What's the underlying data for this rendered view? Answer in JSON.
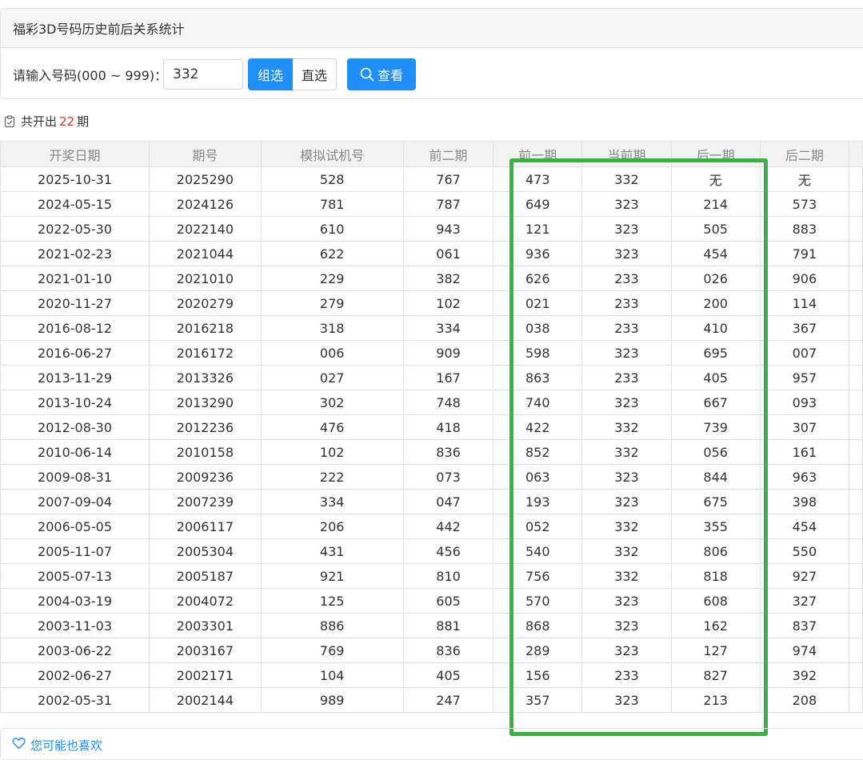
{
  "panel": {
    "title": "福彩3D号码历史前后关系统计",
    "input_label": "请输入号码(000 ~ 999)：",
    "input_value": "332",
    "mode_group": "组选",
    "mode_direct": "直选",
    "search_label": "查看"
  },
  "summary": {
    "prefix": "共开出",
    "count": "22",
    "suffix": "期"
  },
  "table": {
    "headers": [
      "开奖日期",
      "期号",
      "模拟试机号",
      "前二期",
      "前一期",
      "当前期",
      "后一期",
      "后二期"
    ],
    "rows": [
      [
        "2025-10-31",
        "2025290",
        "528",
        "767",
        "473",
        "332",
        "无",
        "无"
      ],
      [
        "2024-05-15",
        "2024126",
        "781",
        "787",
        "649",
        "323",
        "214",
        "573"
      ],
      [
        "2022-05-30",
        "2022140",
        "610",
        "943",
        "121",
        "323",
        "505",
        "883"
      ],
      [
        "2021-02-23",
        "2021044",
        "622",
        "061",
        "936",
        "323",
        "454",
        "791"
      ],
      [
        "2021-01-10",
        "2021010",
        "229",
        "382",
        "626",
        "233",
        "026",
        "906"
      ],
      [
        "2020-11-27",
        "2020279",
        "279",
        "102",
        "021",
        "233",
        "200",
        "114"
      ],
      [
        "2016-08-12",
        "2016218",
        "318",
        "334",
        "038",
        "233",
        "410",
        "367"
      ],
      [
        "2016-06-27",
        "2016172",
        "006",
        "909",
        "598",
        "323",
        "695",
        "007"
      ],
      [
        "2013-11-29",
        "2013326",
        "027",
        "167",
        "863",
        "233",
        "405",
        "957"
      ],
      [
        "2013-10-24",
        "2013290",
        "302",
        "748",
        "740",
        "323",
        "667",
        "093"
      ],
      [
        "2012-08-30",
        "2012236",
        "476",
        "418",
        "422",
        "332",
        "739",
        "307"
      ],
      [
        "2010-06-14",
        "2010158",
        "102",
        "836",
        "852",
        "332",
        "056",
        "161"
      ],
      [
        "2009-08-31",
        "2009236",
        "222",
        "073",
        "063",
        "323",
        "844",
        "963"
      ],
      [
        "2007-09-04",
        "2007239",
        "334",
        "047",
        "193",
        "323",
        "675",
        "398"
      ],
      [
        "2006-05-05",
        "2006117",
        "206",
        "442",
        "052",
        "332",
        "355",
        "454"
      ],
      [
        "2005-11-07",
        "2005304",
        "431",
        "456",
        "540",
        "332",
        "806",
        "550"
      ],
      [
        "2005-07-13",
        "2005187",
        "921",
        "810",
        "756",
        "332",
        "818",
        "927"
      ],
      [
        "2004-03-19",
        "2004072",
        "125",
        "605",
        "570",
        "323",
        "608",
        "327"
      ],
      [
        "2003-11-03",
        "2003301",
        "886",
        "881",
        "868",
        "323",
        "162",
        "837"
      ],
      [
        "2003-06-22",
        "2003167",
        "769",
        "836",
        "289",
        "323",
        "127",
        "974"
      ],
      [
        "2002-06-27",
        "2002171",
        "104",
        "405",
        "156",
        "233",
        "827",
        "392"
      ],
      [
        "2002-05-31",
        "2002144",
        "989",
        "247",
        "357",
        "323",
        "213",
        "208"
      ]
    ]
  },
  "recommend": {
    "label": "您可能也喜欢"
  },
  "colors": {
    "primary": "#1e8ffb",
    "highlight": "#3cb044",
    "count": "#e0352b"
  }
}
